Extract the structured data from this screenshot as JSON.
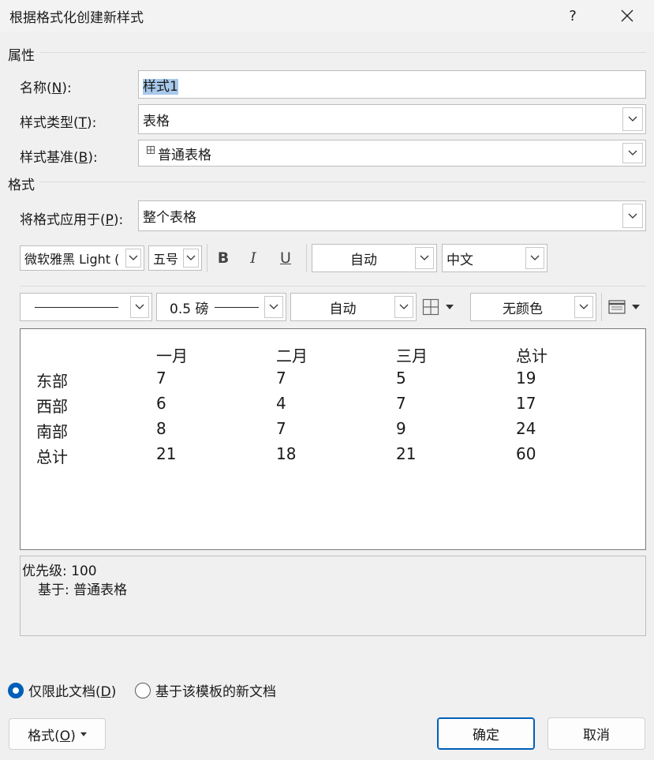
{
  "window": {
    "title": "根据格式化创建新样式",
    "help_label": "?"
  },
  "properties": {
    "section_label": "属性",
    "name_label": "名称(N):",
    "name_value": "样式1",
    "style_type_label": "样式类型(T):",
    "style_type_value": "表格",
    "style_based_label": "样式基准(B):",
    "style_based_value": "普通表格"
  },
  "format": {
    "section_label": "格式",
    "apply_to_label": "将格式应用于(P):",
    "apply_to_value": "整个表格",
    "font_name": "微软雅黑 Light (",
    "font_size": "五号",
    "bold_label": "B",
    "italic_label": "I",
    "underline_label": "U",
    "font_color": "自动",
    "script": "中文",
    "border_weight": "0.5 磅",
    "border_color": "自动",
    "shading": "无颜色"
  },
  "preview": {
    "headers": [
      "",
      "一月",
      "二月",
      "三月",
      "总计"
    ],
    "rows": [
      [
        "东部",
        "7",
        "7",
        "5",
        "19"
      ],
      [
        "西部",
        "6",
        "4",
        "7",
        "17"
      ],
      [
        "南部",
        "8",
        "7",
        "9",
        "24"
      ],
      [
        "总计",
        "21",
        "18",
        "21",
        "60"
      ]
    ]
  },
  "description": {
    "priority": "优先级: 100",
    "based_on": "基于: 普通表格"
  },
  "options": {
    "this_doc": "仅限此文档(D)",
    "template": "基于该模板的新文档"
  },
  "buttons": {
    "format": "格式(O)",
    "ok": "确定",
    "cancel": "取消"
  }
}
